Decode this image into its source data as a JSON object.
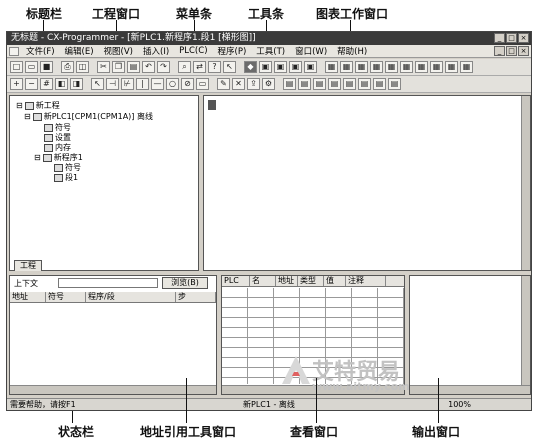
{
  "callouts": {
    "title_bar": "标题栏",
    "project_window": "工程窗口",
    "menu_bar": "菜单条",
    "toolbar": "工具条",
    "diagram_window": "图表工作窗口",
    "status_bar": "状态栏",
    "address_reference_window": "地址引用工具窗口",
    "watch_window": "查看窗口",
    "output_window": "输出窗口"
  },
  "window": {
    "title": "无标题 - CX-Programmer - [新PLC1.新程序1.段1 [梯形图]]"
  },
  "menu": [
    "文件(F)",
    "编辑(E)",
    "视图(V)",
    "插入(I)",
    "PLC(C)",
    "程序(P)",
    "工具(T)",
    "窗口(W)",
    "帮助(H)"
  ],
  "tree": {
    "root": "新工程",
    "plc": "新PLC1[CPM1(CPM1A)] 离线",
    "symbols": "符号",
    "settings": "设置",
    "memory": "内存",
    "program": "新程序1",
    "prog_symbols": "符号",
    "section": "段1",
    "tab": "工程"
  },
  "address_ref": {
    "context_label": "上下文",
    "browse_button": "浏览(B)",
    "columns": [
      "地址",
      "符号",
      "程序/段",
      "步"
    ]
  },
  "watch": {
    "columns": [
      "PLC",
      "名",
      "地址",
      "类型",
      "值",
      "注释"
    ]
  },
  "status": {
    "help_text": "需要帮助，请按F1",
    "plc_name": "新PLC1 - 离线",
    "zoom": "100%"
  },
  "watermark": {
    "brand": "艾特贸易",
    "url": "www.aitmy.com"
  }
}
